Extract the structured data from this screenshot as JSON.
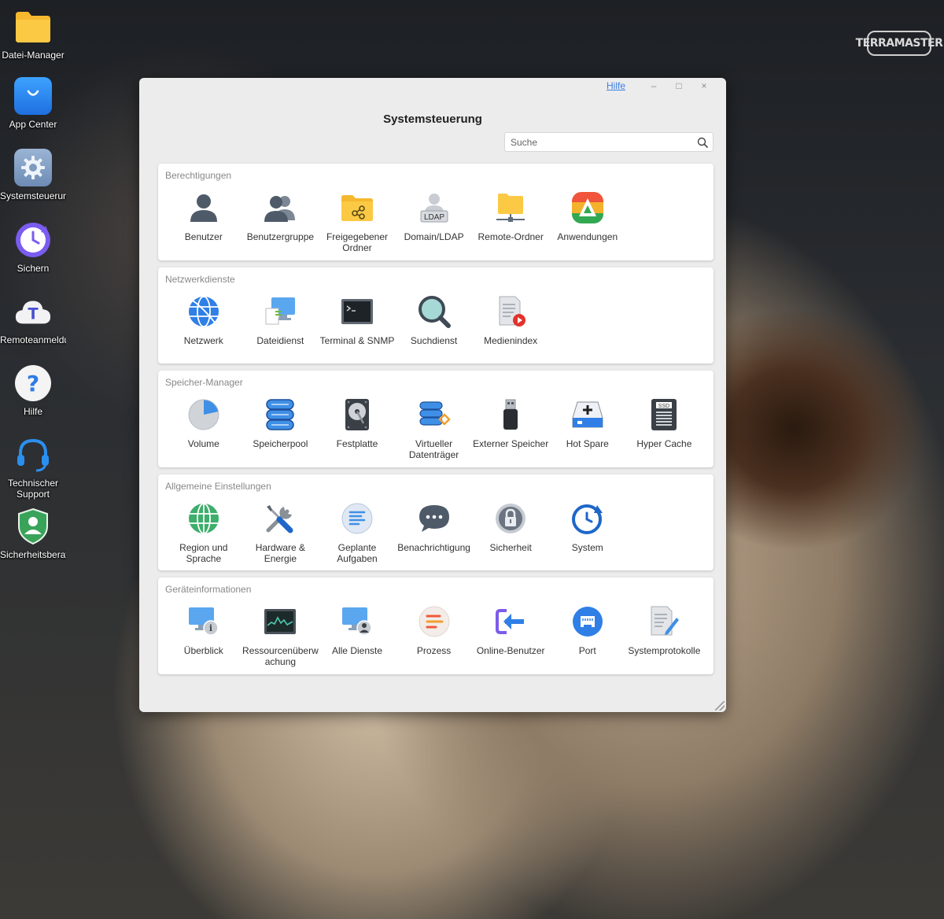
{
  "desktop": {
    "brand_logo_text": "TERRAMASTER",
    "icons": [
      {
        "label": "Datei-Manager",
        "icon": "folder-icon",
        "color": "#f7c43a"
      },
      {
        "label": "App Center",
        "icon": "shopping-bag-icon",
        "color": "#2b8ff0"
      },
      {
        "label": "Systemsteuerun",
        "icon": "gear-icon",
        "color": "#7d9bc0"
      },
      {
        "label": "Sichern",
        "icon": "backup-clock-icon",
        "color": "#7b5cf0"
      },
      {
        "label": "Remoteanmeldu",
        "icon": "cloud-t-icon",
        "color": "#4a4fd0"
      },
      {
        "label": "Hilfe",
        "icon": "question-icon",
        "color": "#2e7be6"
      },
      {
        "label": "Technischer Support",
        "icon": "headset-icon",
        "color": "#2b8ff0"
      },
      {
        "label": "Sicherheitsberat",
        "icon": "shield-user-icon",
        "color": "#3aa35a"
      }
    ]
  },
  "window": {
    "title": "Systemsteuerung",
    "help_label": "Hilfe",
    "minimize_glyph": "–",
    "maximize_glyph": "□",
    "close_glyph": "×",
    "search": {
      "placeholder": "Suche",
      "value": ""
    },
    "sections": [
      {
        "title": "Berechtigungen",
        "items": [
          {
            "label": "Benutzer",
            "icon": "user-icon"
          },
          {
            "label": "Benutzergruppe",
            "icon": "user-group-icon"
          },
          {
            "label": "Freigegebener Ordner",
            "icon": "shared-folder-icon"
          },
          {
            "label": "Domain/LDAP",
            "icon": "ldap-icon",
            "badge": "LDAP"
          },
          {
            "label": "Remote-Ordner",
            "icon": "remote-folder-icon"
          },
          {
            "label": "Anwendungen",
            "icon": "applications-icon"
          }
        ]
      },
      {
        "title": "Netzwerkdienste",
        "items": [
          {
            "label": "Netzwerk",
            "icon": "globe-network-icon"
          },
          {
            "label": "Dateidienst",
            "icon": "file-service-icon"
          },
          {
            "label": "Terminal & SNMP",
            "icon": "terminal-icon"
          },
          {
            "label": "Suchdienst",
            "icon": "magnifier-icon"
          },
          {
            "label": "Medienindex",
            "icon": "media-index-icon"
          }
        ]
      },
      {
        "title": "Speicher-Manager",
        "items": [
          {
            "label": "Volume",
            "icon": "volume-pie-icon"
          },
          {
            "label": "Speicherpool",
            "icon": "storage-pool-icon"
          },
          {
            "label": "Festplatte",
            "icon": "hard-disk-icon"
          },
          {
            "label": "Virtueller Datenträger",
            "icon": "virtual-disk-icon"
          },
          {
            "label": "Externer Speicher",
            "icon": "usb-drive-icon"
          },
          {
            "label": "Hot Spare",
            "icon": "hot-spare-icon"
          },
          {
            "label": "Hyper Cache",
            "icon": "ssd-cache-icon",
            "badge": "SSD"
          }
        ]
      },
      {
        "title": "Allgemeine Einstellungen",
        "items": [
          {
            "label": "Region und Sprache",
            "icon": "region-globe-icon"
          },
          {
            "label": "Hardware & Energie",
            "icon": "tools-icon"
          },
          {
            "label": "Geplante Aufgaben",
            "icon": "scheduled-tasks-icon"
          },
          {
            "label": "Benachrichtigung",
            "icon": "chat-bubble-icon"
          },
          {
            "label": "Sicherheit",
            "icon": "lock-icon"
          },
          {
            "label": "System",
            "icon": "system-clock-icon"
          }
        ]
      },
      {
        "title": "Geräteinformationen",
        "items": [
          {
            "label": "Überblick",
            "icon": "overview-monitor-icon"
          },
          {
            "label": "Ressourcenüberwachung",
            "label_display": "Ressourcenüberw achung",
            "icon": "resource-monitor-icon"
          },
          {
            "label": "Alle Dienste",
            "icon": "all-services-icon"
          },
          {
            "label": "Prozess",
            "icon": "process-icon"
          },
          {
            "label": "Online-Benutzer",
            "icon": "online-user-icon"
          },
          {
            "label": "Port",
            "icon": "port-icon"
          },
          {
            "label": "Systemprotokolle",
            "icon": "system-log-icon"
          }
        ]
      }
    ]
  }
}
